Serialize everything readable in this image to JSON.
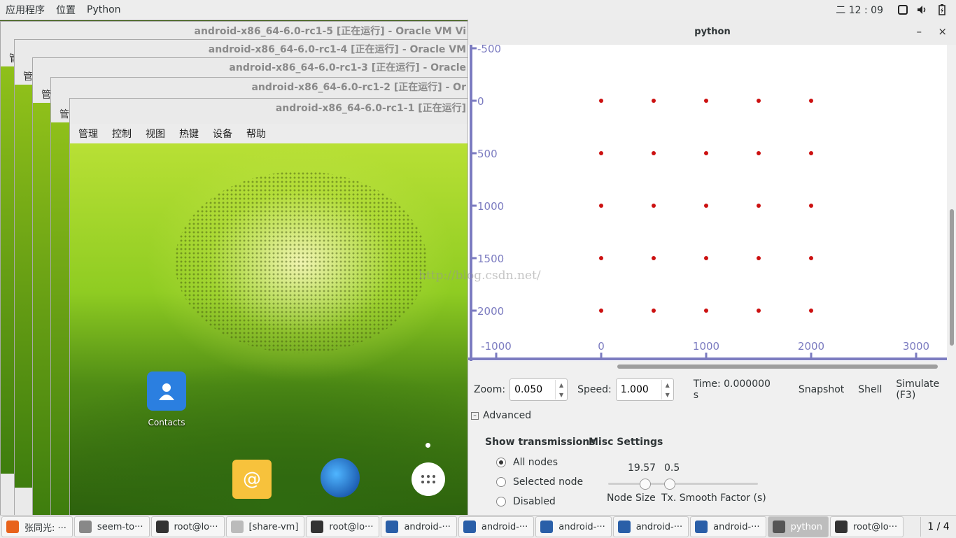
{
  "topbar": {
    "menus": [
      "应用程序",
      "位置",
      "Python"
    ],
    "clock": "二 12 : 09",
    "tray_icons": [
      "window-icon",
      "volume-icon",
      "battery-icon"
    ]
  },
  "vm_windows": [
    {
      "title": "android-x86_64-6.0-rc1-5 [正在运行] - Oracle VM Vi",
      "edge": "管"
    },
    {
      "title": "android-x86_64-6.0-rc1-4 [正在运行] - Oracle VM",
      "edge": "管"
    },
    {
      "title": "android-x86_64-6.0-rc1-3 [正在运行] - Oracle",
      "edge": "管"
    },
    {
      "title": "android-x86_64-6.0-rc1-2 [正在运行] - Or",
      "edge": "管"
    },
    {
      "title": "android-x86_64-6.0-rc1-1 [正在运行]"
    }
  ],
  "vm_menu": [
    "管理",
    "控制",
    "视图",
    "热键",
    "设备",
    "帮助"
  ],
  "android": {
    "contacts_label": "Contacts"
  },
  "python_window": {
    "title": "python",
    "minimize": "–",
    "close": "×"
  },
  "chart_data": {
    "type": "scatter",
    "point_color": "#cc1111",
    "axis_color": "#7b7bc0",
    "x_ticks": [
      "-1000",
      "0",
      "1000",
      "2000",
      "3000"
    ],
    "x_tick_values": [
      -1000,
      0,
      1000,
      2000,
      3000
    ],
    "y_ticks": [
      "-500",
      "0",
      "500",
      "1000",
      "1500",
      "2000"
    ],
    "y_tick_values": [
      -500,
      0,
      500,
      1000,
      1500,
      2000
    ],
    "points": [
      [
        0,
        0
      ],
      [
        500,
        0
      ],
      [
        1000,
        0
      ],
      [
        1500,
        0
      ],
      [
        2000,
        0
      ],
      [
        0,
        500
      ],
      [
        500,
        500
      ],
      [
        1000,
        500
      ],
      [
        1500,
        500
      ],
      [
        2000,
        500
      ],
      [
        0,
        1000
      ],
      [
        500,
        1000
      ],
      [
        1000,
        1000
      ],
      [
        1500,
        1000
      ],
      [
        2000,
        1000
      ],
      [
        0,
        1500
      ],
      [
        500,
        1500
      ],
      [
        1000,
        1500
      ],
      [
        1500,
        1500
      ],
      [
        2000,
        1500
      ],
      [
        0,
        2000
      ],
      [
        500,
        2000
      ],
      [
        1000,
        2000
      ],
      [
        1500,
        2000
      ],
      [
        2000,
        2000
      ]
    ],
    "watermark": "http://blog.csdn.net/"
  },
  "controls": {
    "zoom_label": "Zoom:",
    "zoom_value": "0.050",
    "speed_label": "Speed:",
    "speed_value": "1.000",
    "time": "Time: 0.000000 s",
    "snapshot": "Snapshot",
    "shell": "Shell",
    "simulate": "Simulate (F3)"
  },
  "advanced": {
    "toggle": "–",
    "label": "Advanced",
    "show_transmissions": "Show transmissions",
    "misc_settings": "Misc Settings",
    "options": [
      "All nodes",
      "Selected node",
      "Disabled"
    ],
    "selected_option": "All nodes",
    "node_size_value": "19.57",
    "node_size_label": "Node Size",
    "node_size_level": 0.5,
    "smooth_value": "0.5",
    "smooth_label": "Tx. Smooth Factor (s)",
    "smooth_level": 0.05
  },
  "taskbar": {
    "items": [
      {
        "label": "张同光: ···",
        "icon_color": "#e8631c"
      },
      {
        "label": "seem-to···",
        "icon_color": "#888888"
      },
      {
        "label": "root@lo···",
        "icon_color": "#333333"
      },
      {
        "label": "[share-vm]",
        "icon_color": "#bbbbbb"
      },
      {
        "label": "root@lo···",
        "icon_color": "#333333"
      },
      {
        "label": "android-···",
        "icon_color": "#2a5fa8"
      },
      {
        "label": "android-···",
        "icon_color": "#2a5fa8"
      },
      {
        "label": "android-···",
        "icon_color": "#2a5fa8"
      },
      {
        "label": "android-···",
        "icon_color": "#2a5fa8"
      },
      {
        "label": "android-···",
        "icon_color": "#2a5fa8"
      },
      {
        "label": "python",
        "icon_color": "#555555",
        "active": true
      },
      {
        "label": "root@lo···",
        "icon_color": "#333333"
      }
    ],
    "pager": "1 / 4"
  }
}
